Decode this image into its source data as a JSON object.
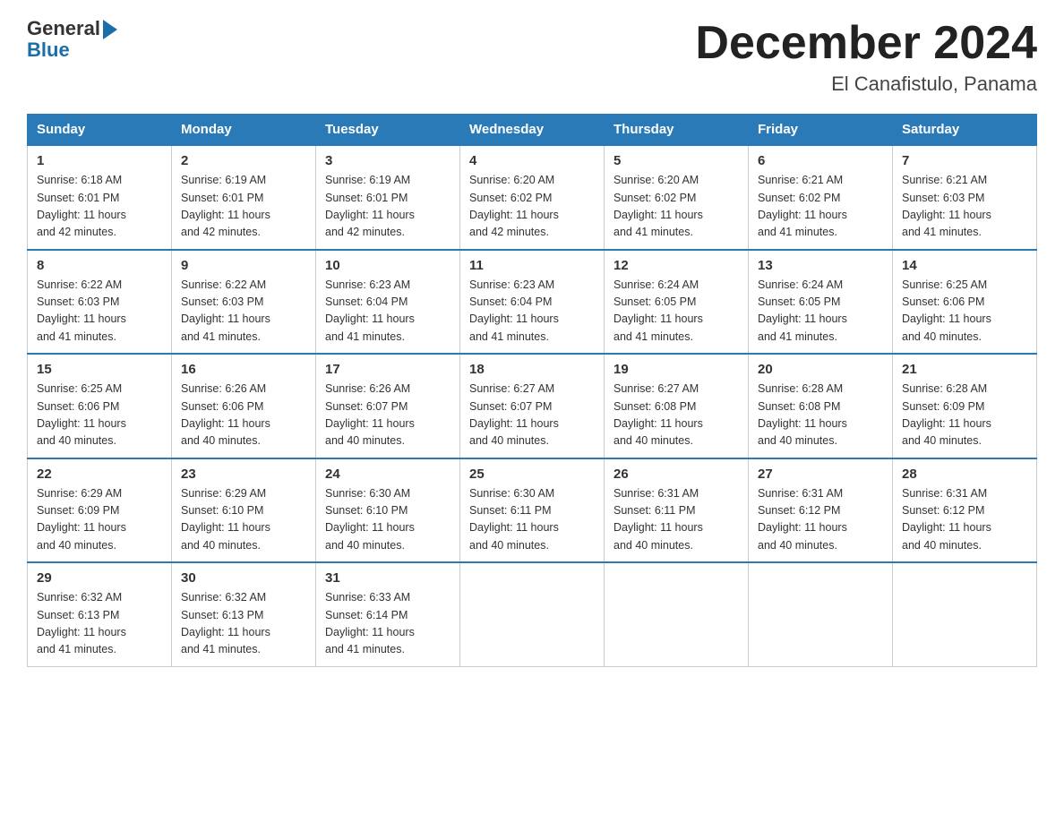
{
  "header": {
    "logo_general": "General",
    "logo_blue": "Blue",
    "month_title": "December 2024",
    "location": "El Canafistulo, Panama"
  },
  "days_of_week": [
    "Sunday",
    "Monday",
    "Tuesday",
    "Wednesday",
    "Thursday",
    "Friday",
    "Saturday"
  ],
  "weeks": [
    [
      {
        "day": "1",
        "sunrise": "6:18 AM",
        "sunset": "6:01 PM",
        "daylight": "11 hours and 42 minutes."
      },
      {
        "day": "2",
        "sunrise": "6:19 AM",
        "sunset": "6:01 PM",
        "daylight": "11 hours and 42 minutes."
      },
      {
        "day": "3",
        "sunrise": "6:19 AM",
        "sunset": "6:01 PM",
        "daylight": "11 hours and 42 minutes."
      },
      {
        "day": "4",
        "sunrise": "6:20 AM",
        "sunset": "6:02 PM",
        "daylight": "11 hours and 42 minutes."
      },
      {
        "day": "5",
        "sunrise": "6:20 AM",
        "sunset": "6:02 PM",
        "daylight": "11 hours and 41 minutes."
      },
      {
        "day": "6",
        "sunrise": "6:21 AM",
        "sunset": "6:02 PM",
        "daylight": "11 hours and 41 minutes."
      },
      {
        "day": "7",
        "sunrise": "6:21 AM",
        "sunset": "6:03 PM",
        "daylight": "11 hours and 41 minutes."
      }
    ],
    [
      {
        "day": "8",
        "sunrise": "6:22 AM",
        "sunset": "6:03 PM",
        "daylight": "11 hours and 41 minutes."
      },
      {
        "day": "9",
        "sunrise": "6:22 AM",
        "sunset": "6:03 PM",
        "daylight": "11 hours and 41 minutes."
      },
      {
        "day": "10",
        "sunrise": "6:23 AM",
        "sunset": "6:04 PM",
        "daylight": "11 hours and 41 minutes."
      },
      {
        "day": "11",
        "sunrise": "6:23 AM",
        "sunset": "6:04 PM",
        "daylight": "11 hours and 41 minutes."
      },
      {
        "day": "12",
        "sunrise": "6:24 AM",
        "sunset": "6:05 PM",
        "daylight": "11 hours and 41 minutes."
      },
      {
        "day": "13",
        "sunrise": "6:24 AM",
        "sunset": "6:05 PM",
        "daylight": "11 hours and 41 minutes."
      },
      {
        "day": "14",
        "sunrise": "6:25 AM",
        "sunset": "6:06 PM",
        "daylight": "11 hours and 40 minutes."
      }
    ],
    [
      {
        "day": "15",
        "sunrise": "6:25 AM",
        "sunset": "6:06 PM",
        "daylight": "11 hours and 40 minutes."
      },
      {
        "day": "16",
        "sunrise": "6:26 AM",
        "sunset": "6:06 PM",
        "daylight": "11 hours and 40 minutes."
      },
      {
        "day": "17",
        "sunrise": "6:26 AM",
        "sunset": "6:07 PM",
        "daylight": "11 hours and 40 minutes."
      },
      {
        "day": "18",
        "sunrise": "6:27 AM",
        "sunset": "6:07 PM",
        "daylight": "11 hours and 40 minutes."
      },
      {
        "day": "19",
        "sunrise": "6:27 AM",
        "sunset": "6:08 PM",
        "daylight": "11 hours and 40 minutes."
      },
      {
        "day": "20",
        "sunrise": "6:28 AM",
        "sunset": "6:08 PM",
        "daylight": "11 hours and 40 minutes."
      },
      {
        "day": "21",
        "sunrise": "6:28 AM",
        "sunset": "6:09 PM",
        "daylight": "11 hours and 40 minutes."
      }
    ],
    [
      {
        "day": "22",
        "sunrise": "6:29 AM",
        "sunset": "6:09 PM",
        "daylight": "11 hours and 40 minutes."
      },
      {
        "day": "23",
        "sunrise": "6:29 AM",
        "sunset": "6:10 PM",
        "daylight": "11 hours and 40 minutes."
      },
      {
        "day": "24",
        "sunrise": "6:30 AM",
        "sunset": "6:10 PM",
        "daylight": "11 hours and 40 minutes."
      },
      {
        "day": "25",
        "sunrise": "6:30 AM",
        "sunset": "6:11 PM",
        "daylight": "11 hours and 40 minutes."
      },
      {
        "day": "26",
        "sunrise": "6:31 AM",
        "sunset": "6:11 PM",
        "daylight": "11 hours and 40 minutes."
      },
      {
        "day": "27",
        "sunrise": "6:31 AM",
        "sunset": "6:12 PM",
        "daylight": "11 hours and 40 minutes."
      },
      {
        "day": "28",
        "sunrise": "6:31 AM",
        "sunset": "6:12 PM",
        "daylight": "11 hours and 40 minutes."
      }
    ],
    [
      {
        "day": "29",
        "sunrise": "6:32 AM",
        "sunset": "6:13 PM",
        "daylight": "11 hours and 41 minutes."
      },
      {
        "day": "30",
        "sunrise": "6:32 AM",
        "sunset": "6:13 PM",
        "daylight": "11 hours and 41 minutes."
      },
      {
        "day": "31",
        "sunrise": "6:33 AM",
        "sunset": "6:14 PM",
        "daylight": "11 hours and 41 minutes."
      },
      null,
      null,
      null,
      null
    ]
  ],
  "labels": {
    "sunrise": "Sunrise:",
    "sunset": "Sunset:",
    "daylight": "Daylight:"
  }
}
